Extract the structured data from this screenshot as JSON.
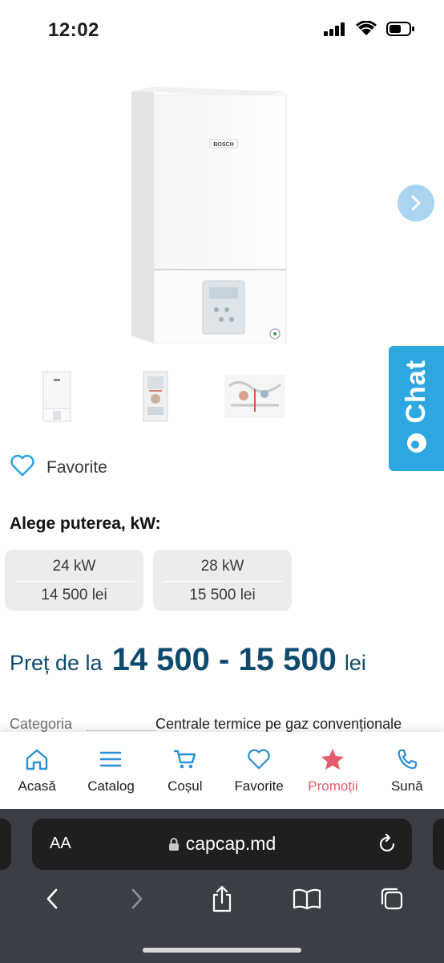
{
  "status": {
    "time": "12:02"
  },
  "product": {
    "brand_logo_text": "BOSCH"
  },
  "chat": {
    "label": "Chat"
  },
  "favorite": {
    "label": "Favorite"
  },
  "power": {
    "title": "Alege puterea, kW:",
    "options": [
      {
        "kw": "24 kW",
        "price": "14 500 lei"
      },
      {
        "kw": "28 kW",
        "price": "15 500 lei"
      }
    ]
  },
  "price": {
    "prefix": "Preț de la",
    "range": "14 500 - 15 500",
    "suffix": "lei"
  },
  "category": {
    "label": "Categoria",
    "value": "Centrale termice pe gaz convenționale"
  },
  "nav": {
    "items": [
      {
        "label": "Acasă",
        "icon": "home-icon"
      },
      {
        "label": "Catalog",
        "icon": "menu-icon"
      },
      {
        "label": "Coșul",
        "icon": "cart-icon"
      },
      {
        "label": "Favorite",
        "icon": "heart-icon"
      },
      {
        "label": "Promoții",
        "icon": "star-icon"
      },
      {
        "label": "Sună",
        "icon": "phone-icon"
      }
    ]
  },
  "browser": {
    "aa": "AA",
    "url": "capcap.md"
  },
  "colors": {
    "accent": "#2ea6e0",
    "price": "#0e4a6e",
    "promo": "#e35d6a",
    "nav_icon": "#2b8fd6"
  }
}
